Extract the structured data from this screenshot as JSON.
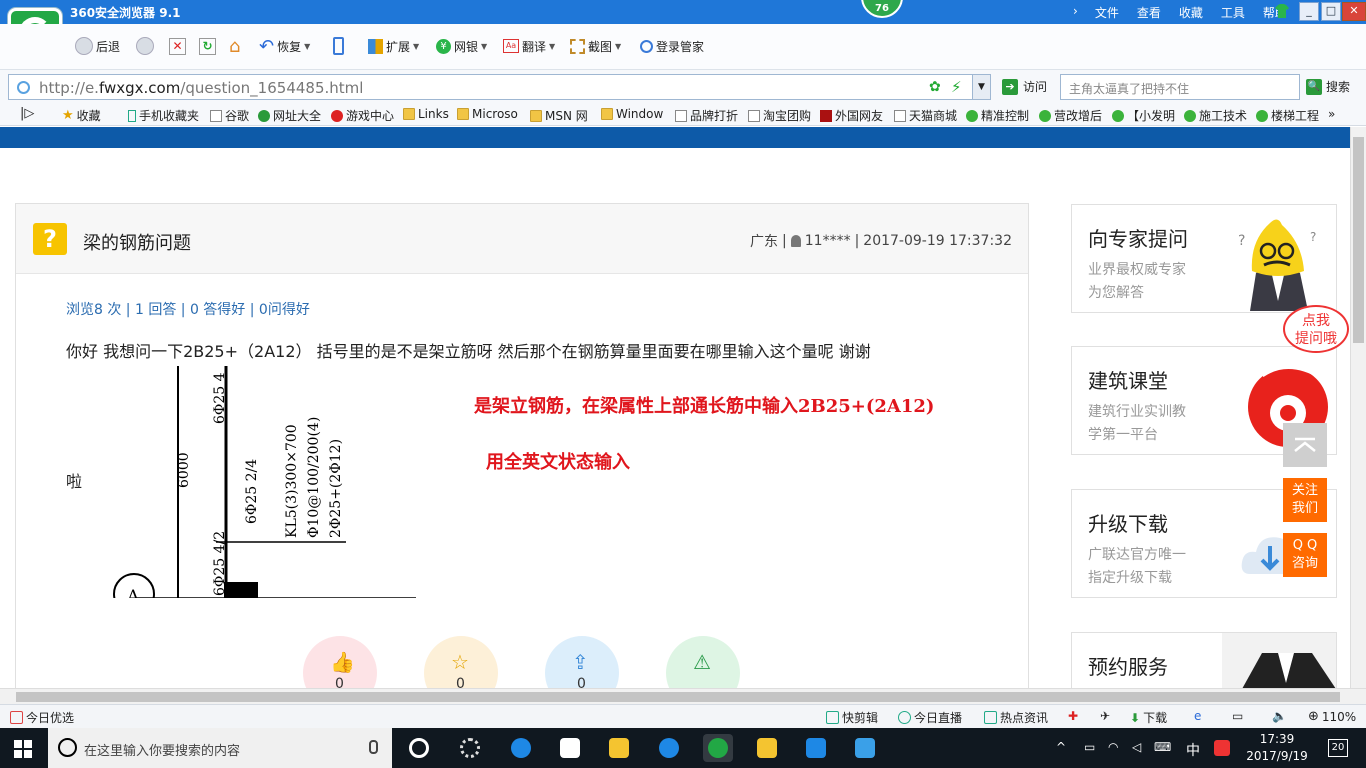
{
  "browser": {
    "title": "360安全浏览器 9.1",
    "badge": "76",
    "menus": [
      "文件",
      "查看",
      "收藏",
      "工具",
      "帮助"
    ],
    "window_controls": [
      "_",
      "□",
      "✕"
    ]
  },
  "toolbar": {
    "back": "后退",
    "restore": "恢复",
    "extensions": "扩展",
    "ebank": "网银",
    "translate": "翻译",
    "screenshot": "截图",
    "login_manager": "登录管家"
  },
  "address": {
    "url_prefix": "http://e.",
    "url_domain": "fwxgx.com",
    "url_path": "/question_1654485.html",
    "visit_label": "访问",
    "search_placeholder": "主角太逼真了把持不住",
    "search_label": "搜索"
  },
  "favorites": [
    {
      "label": "收藏",
      "icon": "star"
    },
    {
      "label": "手机收藏夹",
      "icon": "phone"
    },
    {
      "label": "谷歌",
      "icon": "doc"
    },
    {
      "label": "网址大全",
      "icon": "ie"
    },
    {
      "label": "游戏中心",
      "icon": "red"
    },
    {
      "label": "Links",
      "icon": "folder"
    },
    {
      "label": "Microso",
      "icon": "folder"
    },
    {
      "label": "MSN 网",
      "icon": "folder"
    },
    {
      "label": "Window",
      "icon": "folder"
    },
    {
      "label": "品牌打折",
      "icon": "doc"
    },
    {
      "label": "淘宝团购",
      "icon": "doc"
    },
    {
      "label": "外国网友",
      "icon": "dark"
    },
    {
      "label": "天猫商城",
      "icon": "doc"
    },
    {
      "label": "精准控制",
      "icon": "wechat"
    },
    {
      "label": "营改增后",
      "icon": "wechat"
    },
    {
      "label": "【小发明",
      "icon": "wechat"
    },
    {
      "label": "施工技术",
      "icon": "wechat"
    },
    {
      "label": "楼梯工程",
      "icon": "wechat"
    }
  ],
  "question": {
    "title": "梁的钢筋问题",
    "region": "广东",
    "user": "11****",
    "datetime": "2017-09-19 17:37:32",
    "stats": "浏览8 次 | 1 回答 | 0 答得好 | 0问得好",
    "body": "你好    我想问一下2B25+（2A12）  括号里的是不是架立筋呀  然后那个在钢筋算量里面要在哪里输入这个量呢  谢谢",
    "body_end": "啦",
    "answer_line1": "是架立钢筋，在梁属性上部通长筋中输入2B25+(2A12)",
    "answer_line2": "用全英文状态输入",
    "action_counts": [
      "0",
      "0",
      "0"
    ]
  },
  "drawing": {
    "dim": "6000",
    "bar_top": "6Φ25 4",
    "bar_mid": "6Φ25 2/4",
    "bar_low": "6Φ25 4/2",
    "beam1": "KL5(3)300×700",
    "beam2": "Φ10@100/200(4)",
    "beam3": "2Φ25+(2Φ12)",
    "axis": "A"
  },
  "sidebar": [
    {
      "title": "向专家提问",
      "line1": "业界最权威专家",
      "line2": "为您解答"
    },
    {
      "title": "建筑课堂",
      "line1": "建筑行业实训教",
      "line2": "学第一平台"
    },
    {
      "title": "升级下载",
      "line1": "广联达官方唯一",
      "line2": "指定升级下载"
    },
    {
      "title": "预约服务",
      "line1": "",
      "line2": ""
    }
  ],
  "floating": {
    "bubble_line1": "点我",
    "bubble_line2": "提问哦",
    "follow": "关注\n我们",
    "follow_1": "关注",
    "follow_2": "我们",
    "qq_1": "Q Q",
    "qq_2": "咨询"
  },
  "statusbar": {
    "left": "今日优选",
    "quick_clip": "快剪辑",
    "live": "今日直播",
    "news": "热点资讯",
    "download": "下载",
    "zoom": "110%"
  },
  "taskbar": {
    "search_placeholder": "在这里输入你要搜索的内容",
    "ime": "中",
    "time": "17:39",
    "date": "2017/9/19",
    "notifications": "20"
  },
  "colors": {
    "browser_blue": "#1f77d8",
    "site_blue": "#0d5aa8",
    "answer_red": "#e0161d",
    "orange": "#ff6a00",
    "question_yellow": "#f7c400"
  }
}
